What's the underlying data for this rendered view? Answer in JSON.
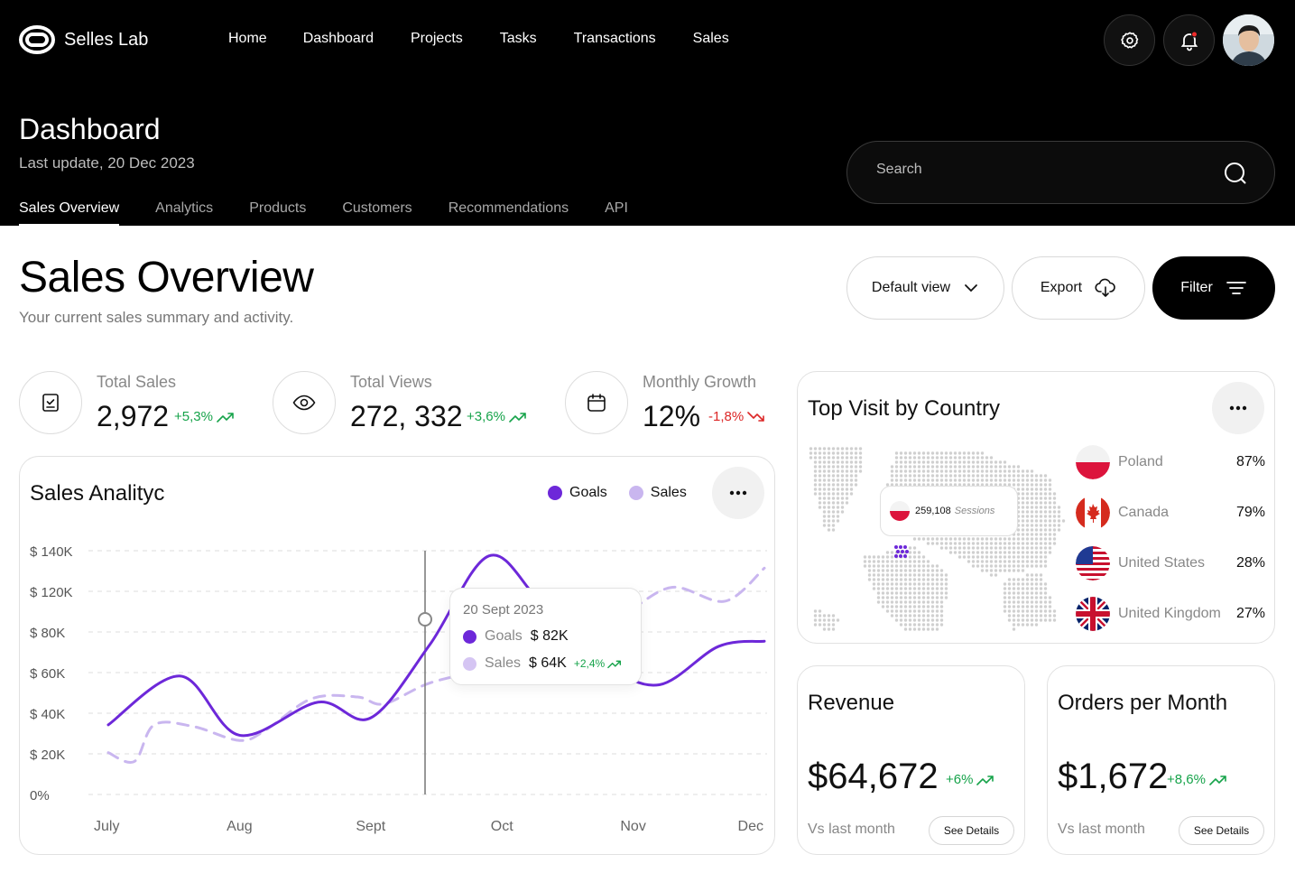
{
  "app": {
    "name": "Selles Lab"
  },
  "nav": {
    "items": [
      "Home",
      "Dashboard",
      "Projects",
      "Tasks",
      "Transactions",
      "Sales"
    ]
  },
  "header": {
    "title": "Dashboard",
    "subtitle": "Last update, 20 Dec 2023",
    "tabs": [
      "Sales Overview",
      "Analytics",
      "Products",
      "Customers",
      "Recommendations",
      "API"
    ],
    "active_tab": "Sales Overview",
    "search_placeholder": "Search"
  },
  "section": {
    "title": "Sales Overview",
    "subtitle": "Your current sales summary and activity.",
    "default_view_label": "Default view",
    "export_label": "Export",
    "filter_label": "Filter"
  },
  "kpis": [
    {
      "label": "Total Sales",
      "value": "2,972",
      "delta": "+5,3%",
      "trend": "up",
      "icon": "checklist-icon"
    },
    {
      "label": "Total Views",
      "value": "272, 332",
      "delta": "+3,6%",
      "trend": "up",
      "icon": "eye-icon"
    },
    {
      "label": "Monthly Growth",
      "value": "12%",
      "delta": "-1,8%",
      "trend": "down",
      "icon": "calendar-icon"
    }
  ],
  "sales_chart": {
    "title": "Sales Analityc",
    "legend": [
      {
        "name": "Goals",
        "color": "#6d28d9"
      },
      {
        "name": "Sales",
        "color": "#c9b6ef"
      }
    ],
    "tooltip": {
      "date": "20 Sept 2023",
      "goals_label": "Goals",
      "goals_value": "$ 82K",
      "sales_label": "Sales",
      "sales_value": "$ 64K",
      "sales_delta": "+2,4%"
    }
  },
  "chart_data": {
    "type": "line",
    "title": "Sales Analityc",
    "categories": [
      "July",
      "Aug",
      "Sept",
      "Oct",
      "Nov",
      "Dec"
    ],
    "y_ticks": [
      "$ 140K",
      "$ 120K",
      "$ 80K",
      "$ 60K",
      "$ 40K",
      "$ 20K",
      "0%"
    ],
    "ylim": [
      0,
      140
    ],
    "grid": true,
    "legend_position": "top-right",
    "series": [
      {
        "name": "Goals",
        "color": "#6d28d9",
        "style": "solid",
        "x": [
          0,
          0.55,
          1.0,
          1.6,
          2.0,
          2.45,
          2.9,
          3.3,
          3.8,
          4.2,
          4.65,
          5.0
        ],
        "values": [
          40,
          68,
          34,
          53,
          44,
          86,
          137,
          110,
          75,
          63,
          85,
          88
        ]
      },
      {
        "name": "Sales",
        "color": "#c9b6ef",
        "style": "dashed",
        "x": [
          0,
          0.2,
          0.35,
          0.65,
          1.0,
          1.2,
          1.55,
          1.9,
          2.1,
          2.45,
          2.9,
          3.3,
          3.6,
          3.95,
          4.3,
          4.7,
          5.0
        ],
        "values": [
          24,
          19,
          40,
          39,
          31,
          37,
          55,
          56,
          52,
          64,
          72,
          78,
          95,
          105,
          119,
          111,
          130
        ]
      }
    ],
    "tooltip_at": "Sept"
  },
  "countries": {
    "title": "Top Visit by Country",
    "session_value": "259,108",
    "session_label": "Sessions",
    "items": [
      {
        "name": "Poland",
        "pct": "87%"
      },
      {
        "name": "Canada",
        "pct": "79%"
      },
      {
        "name": "United States",
        "pct": "28%"
      },
      {
        "name": "United Kingdom",
        "pct": "27%"
      }
    ]
  },
  "revenue": {
    "title": "Revenue",
    "value": "$64,672",
    "delta": "+6%",
    "compare": "Vs last month",
    "details": "See Details"
  },
  "orders": {
    "title": "Orders per Month",
    "value": "$1,672",
    "delta": "+8,6%",
    "compare": "Vs last month",
    "details": "See Details"
  }
}
